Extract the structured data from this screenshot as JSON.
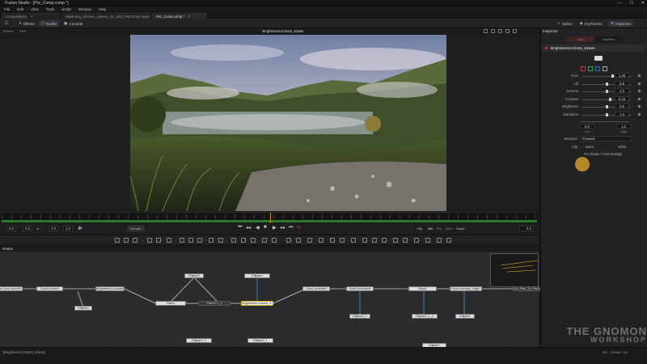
{
  "window": {
    "title": "Fusion Studio - [Pre_Comp.comp *]",
    "buttons": [
      "—",
      "☐",
      "✕"
    ]
  },
  "menu": [
    "File",
    "Edit",
    "View",
    "Tools",
    "Script",
    "Window",
    "Help"
  ],
  "doc_tabs": [
    {
      "label": "Composition1",
      "active": false
    },
    {
      "label": "Mastering_Clemen_Lesson_01_ADS_PreComp.comp *",
      "active": false
    },
    {
      "label": "Pre_Comp.comp *",
      "active": true
    }
  ],
  "toolbar": {
    "effects": "Effects",
    "nodes": "Nodes",
    "console": "Console",
    "spline": "Spline",
    "keyframes": "Keyframes",
    "inspector": "Inspector"
  },
  "viewer": {
    "title": "BrightnessContrast_Estate",
    "left_controls": [
      "100% ▾",
      "Fit ▾"
    ]
  },
  "transport": {
    "start": "0.0",
    "current_left": "0.0",
    "range_end": "0.0",
    "step": "1.0",
    "render_label": "Render",
    "hq": "HQ",
    "mb": "MB",
    "prx": "Prx",
    "aprx": "APrx",
    "some": "Some",
    "frame": "0.0"
  },
  "nodes_panel": {
    "title": "Nodes"
  },
  "nodes": [
    {
      "label": "nColorCorrect1",
      "sel": false
    },
    {
      "label": "ColorCurves1",
      "sel": false
    },
    {
      "label": "BrightnessContrast2",
      "sel": false
    },
    {
      "label": "Ellipse4",
      "sel": false
    },
    {
      "label": "Ellipse3",
      "sel": false
    },
    {
      "label": "Filter1",
      "sel": false
    },
    {
      "label": "FilterLT1_1",
      "sel": false
    },
    {
      "label": "Ellipse2",
      "sel": false
    },
    {
      "label": "BrightnessContrast_E...",
      "sel": true
    },
    {
      "label": "ColorCorrector4",
      "sel": false
    },
    {
      "label": "ColorCorrector5",
      "sel": false
    },
    {
      "label": "Glow1",
      "sel": false
    },
    {
      "label": "ColorCorrector_Highl...",
      "sel": false
    },
    {
      "label": "CH_Pink_To_Pitch_Co...",
      "sel": false
    },
    {
      "label": "Ellipse6_1",
      "sel": false
    },
    {
      "label": "Ellipse4_1_1",
      "sel": false
    },
    {
      "label": "Ellipse1",
      "sel": false
    },
    {
      "label": "Ellipse3_1",
      "sel": false
    },
    {
      "label": "Ellipse2_1",
      "sel": false
    },
    {
      "label": "Ellipse7",
      "sel": false
    }
  ],
  "inspector": {
    "title": "Inspector",
    "tabs": [
      "Tools",
      "Modifiers"
    ],
    "tool_name": "BrightnessContrast_Estate",
    "params": [
      {
        "label": "Gain",
        "value": "1.25",
        "pos": 0.62
      },
      {
        "label": "Lift",
        "value": "0.0",
        "pos": 0.5
      },
      {
        "label": "Gamma",
        "value": "1.0",
        "pos": 0.5
      },
      {
        "label": "Contrast",
        "value": "0.15",
        "pos": 0.56
      },
      {
        "label": "Brightness",
        "value": "0.0",
        "pos": 0.5
      },
      {
        "label": "Saturation",
        "value": "1.0",
        "pos": 0.5
      }
    ],
    "range": {
      "low": "0.0",
      "high": "1.0",
      "low_label": "Low",
      "high_label": "High"
    },
    "direction": {
      "label": "Direction",
      "value": "Forward"
    },
    "clip": {
      "label": "Clip",
      "black": "Black",
      "white": "White"
    },
    "predivide": "Pre-Divide / Post-Multiply"
  },
  "status": {
    "left": "[BrightnessContrast_Estate]",
    "right": "1% · 195160 · 60"
  },
  "watermark": {
    "line1": "THE GNOMON",
    "line2": "WORKSHOP"
  },
  "colors": {
    "accent": "#e0b020",
    "red": "#cf3434",
    "track": "#2d7a2d",
    "cursor": "#e6aa28"
  }
}
